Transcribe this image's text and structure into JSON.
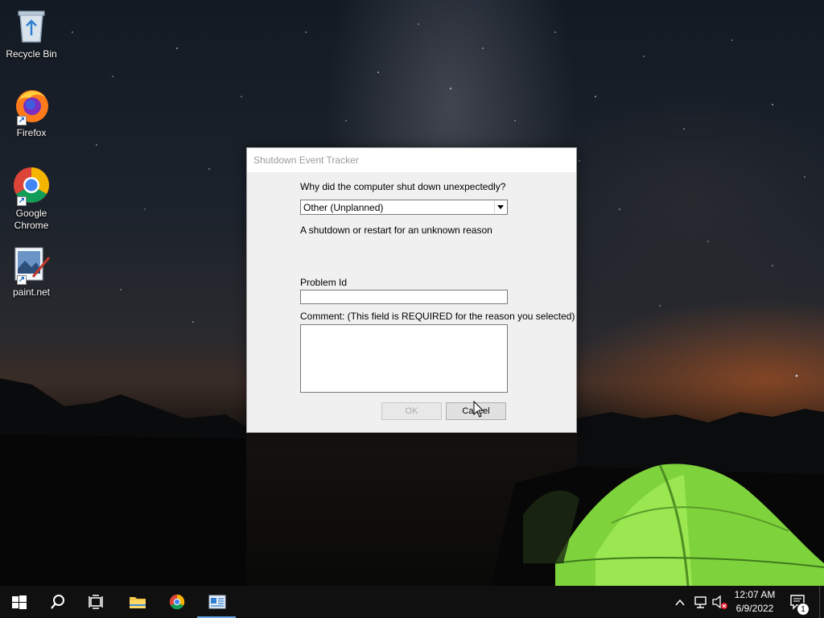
{
  "desktop": {
    "icons": [
      {
        "label": "Recycle Bin",
        "icon": "recycle-bin-icon"
      },
      {
        "label": "Firefox",
        "icon": "firefox-icon"
      },
      {
        "label": "Google Chrome",
        "icon": "chrome-icon"
      },
      {
        "label": "paint.net",
        "icon": "paintnet-icon"
      }
    ]
  },
  "dialog": {
    "title": "Shutdown Event Tracker",
    "question": "Why did the computer shut down unexpectedly?",
    "reason_selected": "Other (Unplanned)",
    "reason_description": "A shutdown or restart for an unknown reason",
    "problem_id_label": "Problem Id",
    "problem_id_value": "",
    "comment_label": "Comment: (This field is REQUIRED for the reason you selected)",
    "comment_value": "",
    "ok_label": "OK",
    "cancel_label": "Cancel"
  },
  "taskbar": {
    "buttons": [
      "start-icon",
      "search-icon",
      "task-view-icon",
      "file-explorer-icon",
      "chrome-icon",
      "shutdown-tracker-app-icon"
    ],
    "active_app": "shutdown-tracker-app-icon",
    "clock_time": "12:07 AM",
    "clock_date": "6/9/2022",
    "notification_count": "1"
  },
  "colors": {
    "accent": "#6aa8e6",
    "taskbar_bg": "#101010",
    "dialog_bg": "#f0f0f0",
    "tent_green": "#8ee04a"
  }
}
